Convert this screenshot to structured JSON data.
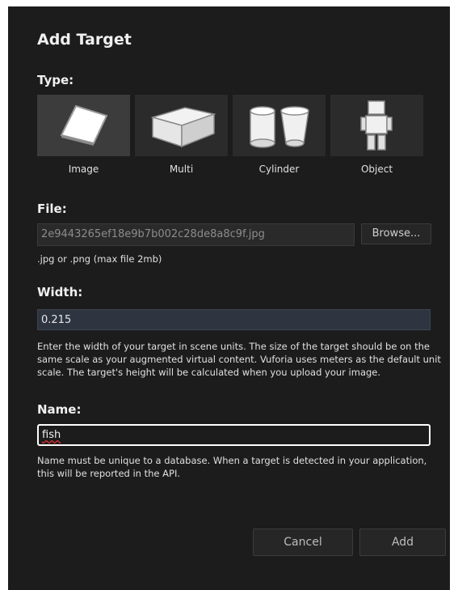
{
  "dialog": {
    "title": "Add Target",
    "type_label": "Type:",
    "types": [
      {
        "label": "Image",
        "icon": "image-target-icon",
        "selected": true
      },
      {
        "label": "Multi",
        "icon": "multi-target-icon",
        "selected": false
      },
      {
        "label": "Cylinder",
        "icon": "cylinder-target-icon",
        "selected": false
      },
      {
        "label": "Object",
        "icon": "object-target-icon",
        "selected": false
      }
    ],
    "file": {
      "label": "File:",
      "value": "2e9443265ef18e9b7b002c28de8a8c9f.jpg",
      "browse_label": "Browse...",
      "hint": ".jpg or .png (max file 2mb)"
    },
    "width": {
      "label": "Width:",
      "value": "0.215",
      "hint": "Enter the width of your target in scene units. The size of the target should be on the same scale as your augmented virtual content. Vuforia uses meters as the default unit scale. The target's height will be calculated when you upload your image."
    },
    "name": {
      "label": "Name:",
      "value": "fish",
      "hint": "Name must be unique to a database. When a target is detected in your application, this will be reported in the API."
    },
    "buttons": {
      "cancel": "Cancel",
      "add": "Add"
    }
  },
  "colors": {
    "dialog_bg": "#1c1c1c",
    "tile_bg": "#2b2b2b",
    "tile_selected_bg": "#3c3c3c",
    "field_bg": "#2e3440",
    "name_field_border": "#ffffff"
  }
}
